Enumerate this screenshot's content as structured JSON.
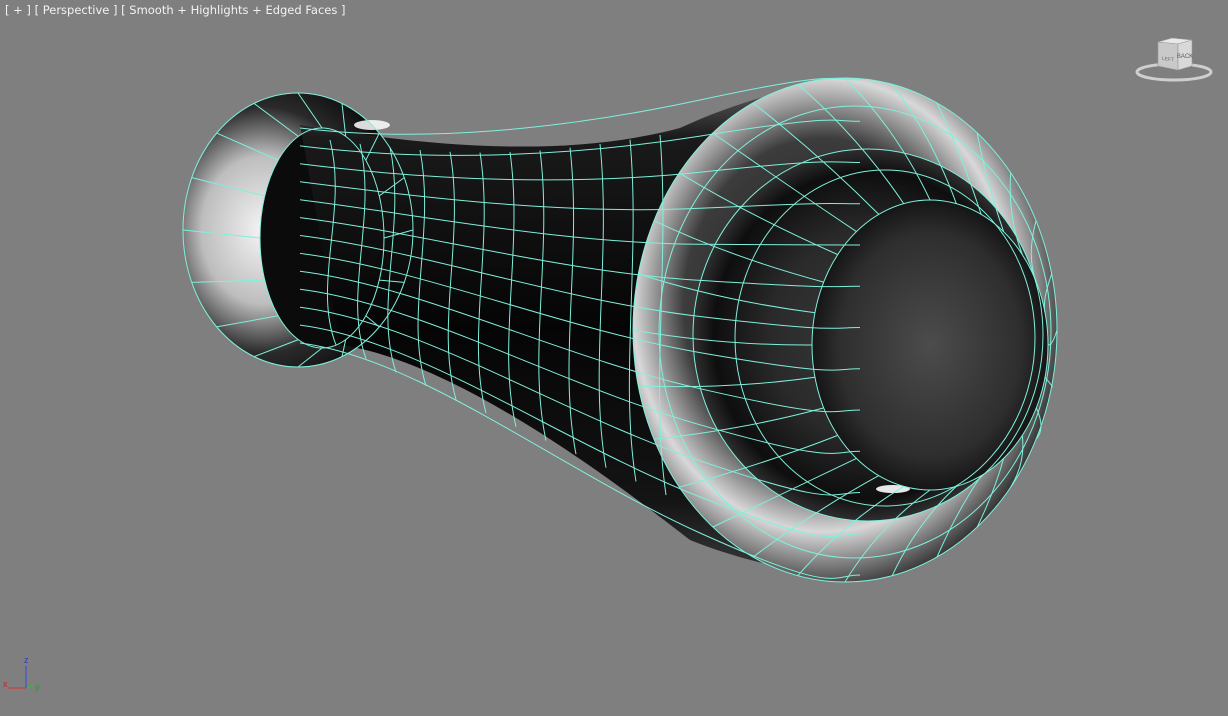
{
  "viewport": {
    "label_plus": "[ + ]",
    "label_view": "[ Perspective ]",
    "label_shading": "[ Smooth + Highlights + Edged Faces ]",
    "background_color": "#7f7f7f",
    "wire_color": "#7ff0dc"
  },
  "viewcube": {
    "face_back": "BACK",
    "face_side": "LEFT"
  },
  "axis_tripod": {
    "x": "x",
    "y": "y",
    "z": "z"
  }
}
